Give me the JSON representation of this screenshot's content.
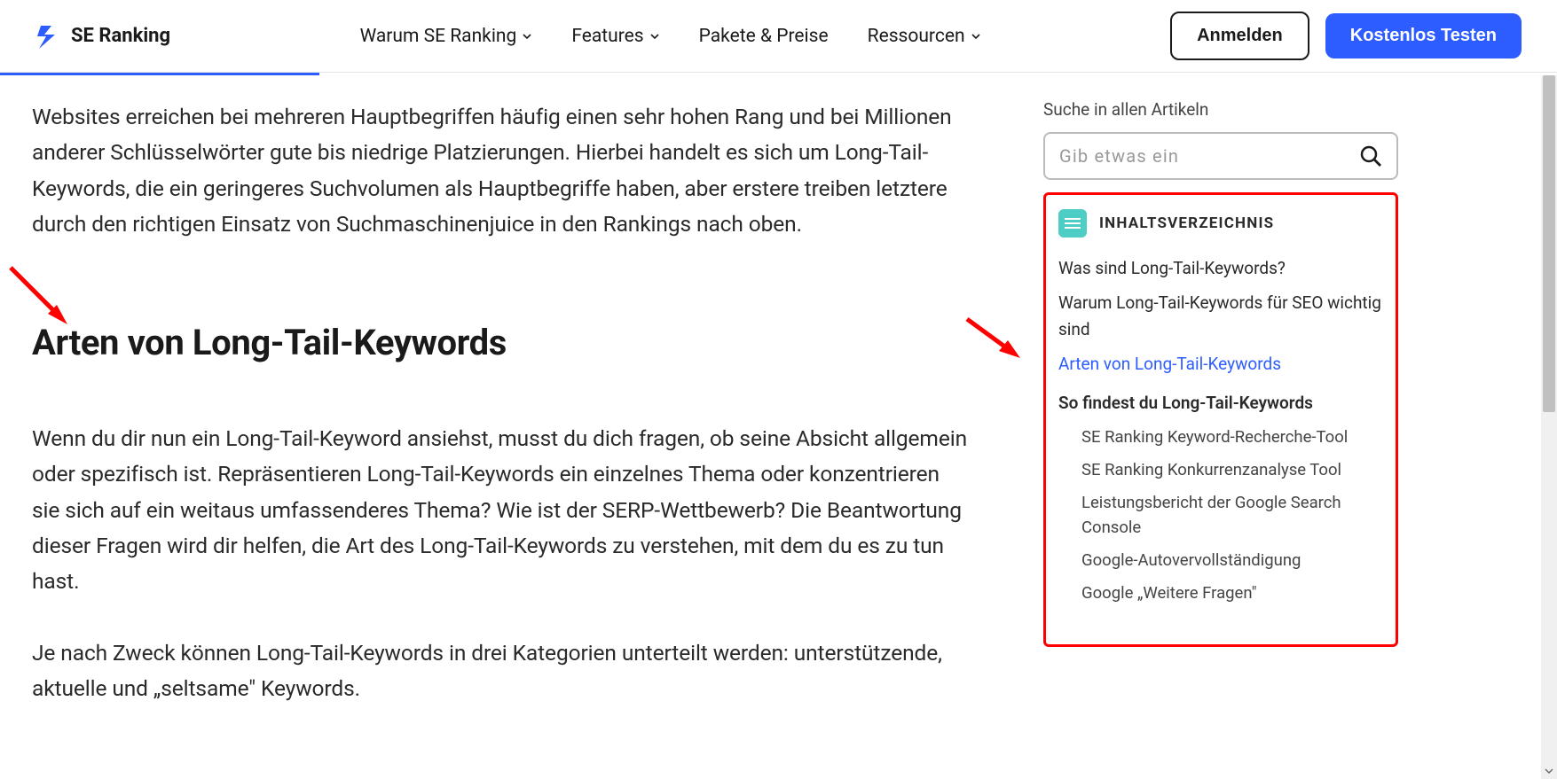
{
  "header": {
    "logo_text": "SE Ranking",
    "nav": [
      {
        "label": "Warum SE Ranking",
        "has_dropdown": true
      },
      {
        "label": "Features",
        "has_dropdown": true
      },
      {
        "label": "Pakete & Preise",
        "has_dropdown": false
      },
      {
        "label": "Ressourcen",
        "has_dropdown": true
      }
    ],
    "login_label": "Anmelden",
    "trial_label": "Kostenlos Testen"
  },
  "content": {
    "intro_paragraph": "Websites erreichen bei mehreren Hauptbegriffen häufig einen sehr hohen Rang und bei Millionen anderer Schlüsselwörter gute bis niedrige Platzierungen. Hierbei handelt es sich um Long-Tail-Keywords, die ein geringeres Suchvolumen als Hauptbegriffe haben, aber erstere treiben letztere durch den richtigen Einsatz von Suchmaschinenjuice in den Rankings nach oben.",
    "heading": "Arten von Long-Tail-Keywords",
    "para2": "Wenn du dir nun ein Long-Tail-Keyword ansiehst, musst du dich fragen, ob seine Absicht allgemein oder spezifisch ist. Repräsentieren Long-Tail-Keywords ein einzelnes Thema oder konzentrieren sie sich auf ein weitaus umfassenderes Thema? Wie ist der SERP-Wettbewerb? Die Beantwortung dieser Fragen wird dir helfen, die Art des Long-Tail-Keywords zu verstehen, mit dem du es zu tun hast.",
    "para3": "Je nach Zweck können Long-Tail-Keywords in drei Kategorien unterteilt werden: unterstützende, aktuelle und „seltsame\" Keywords."
  },
  "sidebar": {
    "search_label": "Suche in allen Artikeln",
    "search_placeholder": "Gib etwas ein",
    "toc_title": "INHALTSVERZEICHNIS",
    "toc_items": [
      {
        "label": "Was sind Long-Tail-Keywords?",
        "active": false
      },
      {
        "label": "Warum Long-Tail-Keywords für SEO wichtig sind",
        "active": false
      },
      {
        "label": "Arten von Long-Tail-Keywords",
        "active": true
      },
      {
        "label": "So findest du Long-Tail-Keywords",
        "active": false,
        "bold": true
      }
    ],
    "toc_subitems": [
      "SE Ranking Keyword-Recherche-Tool",
      "SE Ranking Konkurrenzanalyse Tool",
      "Leistungsbericht der Google Search Console",
      "Google-Autovervollständigung",
      "Google „Weitere Fragen\""
    ]
  }
}
